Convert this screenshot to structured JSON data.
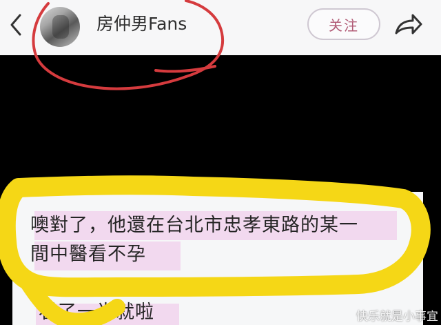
{
  "header": {
    "account_name": "房仲男Fans",
    "follow_label": "关注"
  },
  "icons": {
    "back": "chevron-left-icon",
    "share": "share-arrow-icon"
  },
  "post": {
    "message_line_1": "噢對了，他還在台北市忠孝東路的某一",
    "message_line_2": "間中醫看不孕",
    "reply_text": "看了一半就啦",
    "watermark": "快乐就是小事宜"
  },
  "colors": {
    "follow_text": "#b15b76",
    "highlight": "#ebb1e2",
    "red_annotation": "#d53b3e",
    "yellow_annotation": "#f5d716"
  }
}
